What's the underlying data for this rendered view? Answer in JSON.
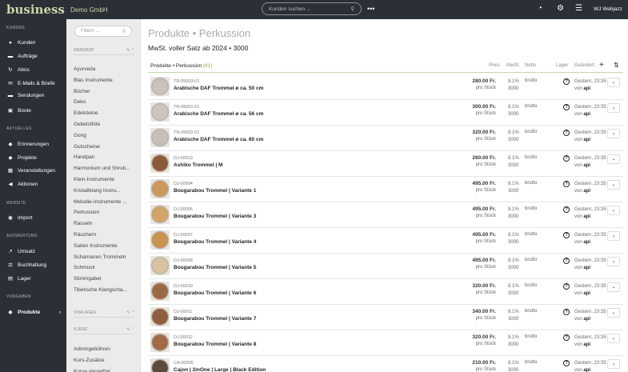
{
  "topbar": {
    "logo": "business",
    "company": "Demo GmbH",
    "search_placeholder": "Kunden suchen ...",
    "more": "•••",
    "user": "WJ Webjazz"
  },
  "sidebar": {
    "sections": [
      {
        "label": "KUNDEN"
      },
      {
        "label": "AKTUELLES"
      },
      {
        "label": "WEBSITE"
      },
      {
        "label": "AUSWERTUNG"
      },
      {
        "label": "VORGABEN"
      }
    ],
    "items": [
      {
        "label": "Kunden",
        "icon": "person-icon"
      },
      {
        "label": "Aufträge",
        "icon": "truck-icon"
      },
      {
        "label": "Abos",
        "icon": "refresh-icon"
      },
      {
        "label": "E-Mails & Briefe",
        "icon": "send-icon"
      },
      {
        "label": "Sendungen",
        "icon": "truck-icon"
      },
      {
        "label": "Boote",
        "icon": "briefcase-icon"
      },
      {
        "label": "Erinnerungen",
        "icon": "bell-icon"
      },
      {
        "label": "Projekte",
        "icon": "projects-icon"
      },
      {
        "label": "Veranstaltungen",
        "icon": "calendar-icon"
      },
      {
        "label": "Aktionen",
        "icon": "megaphone-icon"
      },
      {
        "label": "Import",
        "icon": "globe-icon"
      },
      {
        "label": "Umsatz",
        "icon": "chart-icon"
      },
      {
        "label": "Buchhaltung",
        "icon": "scale-icon"
      },
      {
        "label": "Lager",
        "icon": "warehouse-icon"
      },
      {
        "label": "Produkte",
        "icon": "tag-icon"
      }
    ]
  },
  "sidebar2": {
    "filter_placeholder": "Filtern ...",
    "webshop_label": "WEBSHOP",
    "vorlagen_label": "VORLAGEN",
    "kurse_label": "KURSE",
    "webshop_items": [
      "Ayurveda",
      "Blas Instrumente",
      "Bücher",
      "Deko",
      "Edelsteine",
      "Gebetsflöte",
      "Gong",
      "Gutscheine",
      "Handpan",
      "Harmonium und Shruti...",
      "Klein-Instrumente",
      "Kristallklang Instru...",
      "Melodie-Instrumente ...",
      "Perkussion",
      "Rasseln",
      "Räuchern",
      "Saiten Instrumente",
      "Schamanen Trommeln",
      "Schmuck",
      "Stimmgabel",
      "Tibetische Klangscha..."
    ],
    "kurse_items": [
      "Admingebühren",
      "Kurs-Zusätze",
      "Kurse steuerfrei"
    ]
  },
  "main": {
    "title": "Produkte • Perkussion",
    "subtitle": "MwSt. voller Satz ab 2024 • 3000",
    "header": {
      "name": "Produkte • Perkussion",
      "count": "(81)",
      "preis": "Preis",
      "mwst": "MwSt.",
      "netto": "Netto",
      "lager": "Lager",
      "geaendert": "Geändert",
      "add": "+",
      "sort": "⇅"
    },
    "rows": [
      {
        "sku": "TR-05003-01",
        "name": "Arabische DAF Trommel ø ca. 50 cm",
        "price": "280.00 Fr.",
        "unit": "pro Stück",
        "tax": "8.1%",
        "taxcode": "3000",
        "netto": "brutto",
        "lager": "?",
        "changed": "Gestern, 23:35",
        "by_prefix": "von",
        "by": "api",
        "thumb": "#c8c3bb"
      },
      {
        "sku": "TR-05001-01",
        "name": "Arabische DAF Trommel ø ca. 56 cm",
        "price": "300.00 Fr.",
        "unit": "pro Stück",
        "tax": "8.1%",
        "taxcode": "3000",
        "netto": "brutto",
        "lager": "?",
        "changed": "Gestern, 23:35",
        "by_prefix": "von",
        "by": "api",
        "thumb": "#cbc5bc"
      },
      {
        "sku": "TR-05002-01",
        "name": "Arabische DAF Trommel ø ca. 60 cm",
        "price": "320.00 Fr.",
        "unit": "pro Stück",
        "tax": "8.1%",
        "taxcode": "3000",
        "netto": "brutto",
        "lager": "?",
        "changed": "Gestern, 23:35",
        "by_prefix": "von",
        "by": "api",
        "thumb": "#c6c0b8"
      },
      {
        "sku": "DJ-00013",
        "name": "Ashiko Trommel | M",
        "price": "260.00 Fr.",
        "unit": "pro Stück",
        "tax": "8.1%",
        "taxcode": "3000",
        "netto": "brutto",
        "lager": "?",
        "changed": "Gestern, 23:35",
        "by_prefix": "von",
        "by": "api",
        "thumb": "#8b5a3a"
      },
      {
        "sku": "DJ-00004",
        "name": "Bougarabou Trommel | Variante 1",
        "price": "495.00 Fr.",
        "unit": "pro Stück",
        "tax": "8.1%",
        "taxcode": "3000",
        "netto": "brutto",
        "lager": "?",
        "changed": "Gestern, 23:35",
        "by_prefix": "von",
        "by": "api",
        "thumb": "#c99a5b"
      },
      {
        "sku": "DJ-00005",
        "name": "Bougarabou Trommel | Variante 3",
        "price": "495.00 Fr.",
        "unit": "pro Stück",
        "tax": "8.1%",
        "taxcode": "3000",
        "netto": "brutto",
        "lager": "?",
        "changed": "Gestern, 23:35",
        "by_prefix": "von",
        "by": "api",
        "thumb": "#d2a466"
      },
      {
        "sku": "DJ-00007",
        "name": "Bougarabou Trommel | Variante 4",
        "price": "495.00 Fr.",
        "unit": "pro Stück",
        "tax": "8.1%",
        "taxcode": "3000",
        "netto": "brutto",
        "lager": "?",
        "changed": "Gestern, 23:35",
        "by_prefix": "von",
        "by": "api",
        "thumb": "#c8944f"
      },
      {
        "sku": "DJ-00008",
        "name": "Bougarabou Trommel | Variante 5",
        "price": "495.00 Fr.",
        "unit": "pro Stück",
        "tax": "8.1%",
        "taxcode": "3000",
        "netto": "brutto",
        "lager": "?",
        "changed": "Gestern, 23:35",
        "by_prefix": "von",
        "by": "api",
        "thumb": "#d9c3a0"
      },
      {
        "sku": "DJ-00010",
        "name": "Bougarabou Trommel | Variante 6",
        "price": "320.00 Fr.",
        "unit": "pro Stück",
        "tax": "8.1%",
        "taxcode": "3000",
        "netto": "brutto",
        "lager": "?",
        "changed": "Gestern, 23:35",
        "by_prefix": "von",
        "by": "api",
        "thumb": "#9a6a45"
      },
      {
        "sku": "DJ-00011",
        "name": "Bougarabou Trommel | Variante 7",
        "price": "340.00 Fr.",
        "unit": "pro Stück",
        "tax": "8.1%",
        "taxcode": "3000",
        "netto": "brutto",
        "lager": "?",
        "changed": "Gestern, 23:35",
        "by_prefix": "von",
        "by": "api",
        "thumb": "#8e5f3e"
      },
      {
        "sku": "DJ-00012",
        "name": "Bougarabou Trommel | Variante 8",
        "price": "320.00 Fr.",
        "unit": "pro Stück",
        "tax": "8.1%",
        "taxcode": "3000",
        "netto": "brutto",
        "lager": "?",
        "changed": "Gestern, 23:35",
        "by_prefix": "von",
        "by": "api",
        "thumb": "#a06c48"
      },
      {
        "sku": "CA-00005",
        "name": "Cajon | 2inOne | Large | Black Edition",
        "price": "210.00 Fr.",
        "unit": "pro Stück",
        "tax": "8.1%",
        "taxcode": "3000",
        "netto": "brutto",
        "lager": "?",
        "changed": "Gestern, 23:35",
        "by_prefix": "von",
        "by": "api",
        "thumb": "#5a4a3c"
      }
    ]
  }
}
